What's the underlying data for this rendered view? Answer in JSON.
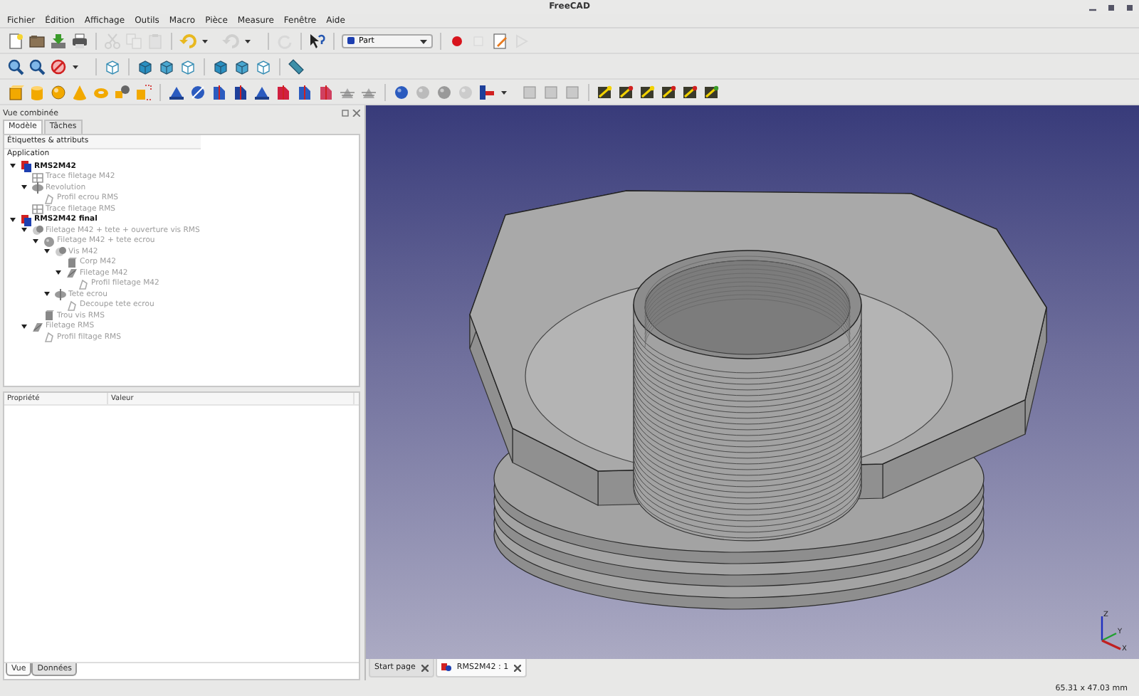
{
  "window": {
    "title": "FreeCAD"
  },
  "menu": [
    "Fichier",
    "Édition",
    "Affichage",
    "Outils",
    "Macro",
    "Pièce",
    "Measure",
    "Fenêtre",
    "Aide"
  ],
  "workbench": {
    "value": "Part"
  },
  "panel": {
    "title": "Vue combinée",
    "tabs": [
      {
        "label": "Modèle",
        "selected": true
      },
      {
        "label": "Tâches",
        "selected": false
      }
    ],
    "tree": {
      "header": "Étiquettes & attributs",
      "root": "Application",
      "items": [
        {
          "label": "RMS2M42",
          "kind": "document",
          "visible": true,
          "expanded": true,
          "children": [
            {
              "label": "Trace filetage M42",
              "kind": "wire",
              "visible": false
            },
            {
              "label": "Revolution",
              "kind": "revolution",
              "visible": false,
              "expanded": true,
              "children": [
                {
                  "label": "Profil ecrou RMS",
                  "kind": "sketch",
                  "visible": false
                }
              ]
            },
            {
              "label": "Trace filetage RMS",
              "kind": "wire",
              "visible": false
            }
          ]
        },
        {
          "label": "RMS2M42 final",
          "kind": "document",
          "visible": true,
          "expanded": true,
          "children": [
            {
              "label": "Filetage M42 + tete + ouverture vis RMS",
              "kind": "cut",
              "visible": false,
              "expanded": true,
              "children": [
                {
                  "label": "Filetage M42 + tete ecrou",
                  "kind": "fusion",
                  "visible": false,
                  "expanded": true,
                  "children": [
                    {
                      "label": "Vis M42",
                      "kind": "cut",
                      "visible": false,
                      "expanded": true,
                      "children": [
                        {
                          "label": "Corp M42",
                          "kind": "extrude",
                          "visible": false
                        },
                        {
                          "label": "Filetage M42",
                          "kind": "sweep",
                          "visible": false,
                          "expanded": true,
                          "children": [
                            {
                              "label": "Profil filetage M42",
                              "kind": "sketch",
                              "visible": false
                            }
                          ]
                        }
                      ]
                    },
                    {
                      "label": "Tete ecrou",
                      "kind": "revolution",
                      "visible": false,
                      "expanded": true,
                      "children": [
                        {
                          "label": "Decoupe tete ecrou",
                          "kind": "sketch",
                          "visible": false
                        }
                      ]
                    }
                  ]
                },
                {
                  "label": "Trou vis RMS",
                  "kind": "extrude",
                  "visible": false
                }
              ]
            },
            {
              "label": "Filetage RMS",
              "kind": "sweep",
              "visible": false,
              "expanded": true,
              "children": [
                {
                  "label": "Profil filtage RMS",
                  "kind": "sketch",
                  "visible": false
                }
              ]
            }
          ]
        }
      ]
    }
  },
  "properties": {
    "columns": [
      "Propriété",
      "Valeur"
    ],
    "tabs": [
      {
        "label": "Vue",
        "selected": true
      },
      {
        "label": "Données",
        "selected": false
      }
    ]
  },
  "viewport": {
    "axes": [
      "Z",
      "Y",
      "X"
    ]
  },
  "doc_tabs": [
    {
      "label": "Start page",
      "selected": false
    },
    {
      "label": "RMS2M42 : 1",
      "selected": true
    }
  ],
  "status_bar": {
    "dimensions": "65.31 x 47.03 mm"
  }
}
